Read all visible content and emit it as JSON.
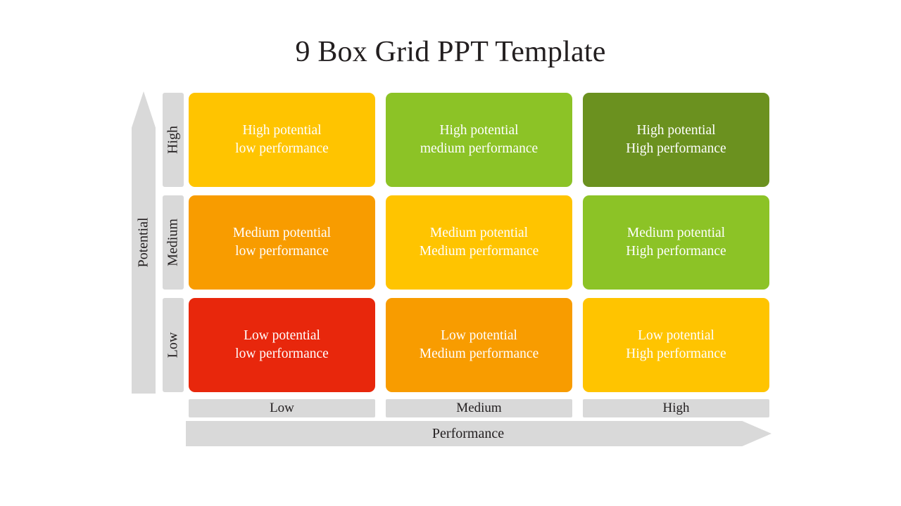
{
  "slide": {
    "title": "9 Box Grid PPT Template",
    "background_color": "#ffffff"
  },
  "axes": {
    "y": {
      "name": "Potential",
      "arrow_direction": "up",
      "axis_color": "#d9d9d9",
      "levels": [
        {
          "label": "High"
        },
        {
          "label": "Medium"
        },
        {
          "label": "Low"
        }
      ]
    },
    "x": {
      "name": "Performance",
      "arrow_direction": "right",
      "axis_color": "#d9d9d9",
      "levels": [
        {
          "label": "Low"
        },
        {
          "label": "Medium"
        },
        {
          "label": "High"
        }
      ]
    }
  },
  "grid": {
    "rows": [
      {
        "potential": "High",
        "cells": [
          {
            "line1": "High potential",
            "line2": "low performance",
            "color": "#ffc400",
            "text_color": "#ffffff"
          },
          {
            "line1": "High potential",
            "line2": "medium performance",
            "color": "#8cc326",
            "text_color": "#ffffff"
          },
          {
            "line1": "High potential",
            "line2": "High performance",
            "color": "#6b911f",
            "text_color": "#ffffff"
          }
        ]
      },
      {
        "potential": "Medium",
        "cells": [
          {
            "line1": "Medium potential",
            "line2": "low performance",
            "color": "#f89c00",
            "text_color": "#ffffff"
          },
          {
            "line1": "Medium potential",
            "line2": "Medium performance",
            "color": "#ffc400",
            "text_color": "#ffffff"
          },
          {
            "line1": "Medium potential",
            "line2": "High performance",
            "color": "#8cc326",
            "text_color": "#ffffff"
          }
        ]
      },
      {
        "potential": "Low",
        "cells": [
          {
            "line1": "Low potential",
            "line2": "low performance",
            "color": "#e8270c",
            "text_color": "#ffffff"
          },
          {
            "line1": "Low potential",
            "line2": "Medium performance",
            "color": "#f89c00",
            "text_color": "#ffffff"
          },
          {
            "line1": "Low potential",
            "line2": "High performance",
            "color": "#ffc400",
            "text_color": "#ffffff"
          }
        ]
      }
    ]
  },
  "chart_data": {
    "type": "heatmap",
    "title": "9 Box Grid PPT Template",
    "xlabel": "Performance",
    "ylabel": "Potential",
    "x_categories": [
      "Low",
      "Medium",
      "High"
    ],
    "y_categories": [
      "High",
      "Medium",
      "Low"
    ],
    "legend": "none",
    "grid": "off",
    "cells": [
      {
        "x": "Low",
        "y": "High",
        "label": "High potential low performance",
        "color": "#ffc400"
      },
      {
        "x": "Medium",
        "y": "High",
        "label": "High potential medium performance",
        "color": "#8cc326"
      },
      {
        "x": "High",
        "y": "High",
        "label": "High potential High performance",
        "color": "#6b911f"
      },
      {
        "x": "Low",
        "y": "Medium",
        "label": "Medium potential low performance",
        "color": "#f89c00"
      },
      {
        "x": "Medium",
        "y": "Medium",
        "label": "Medium potential Medium performance",
        "color": "#ffc400"
      },
      {
        "x": "High",
        "y": "Medium",
        "label": "Medium potential High performance",
        "color": "#8cc326"
      },
      {
        "x": "Low",
        "y": "Low",
        "label": "Low potential low performance",
        "color": "#e8270c"
      },
      {
        "x": "Medium",
        "y": "Low",
        "label": "Low potential Medium performance",
        "color": "#f89c00"
      },
      {
        "x": "High",
        "y": "Low",
        "label": "Low potential High performance",
        "color": "#ffc400"
      }
    ]
  }
}
